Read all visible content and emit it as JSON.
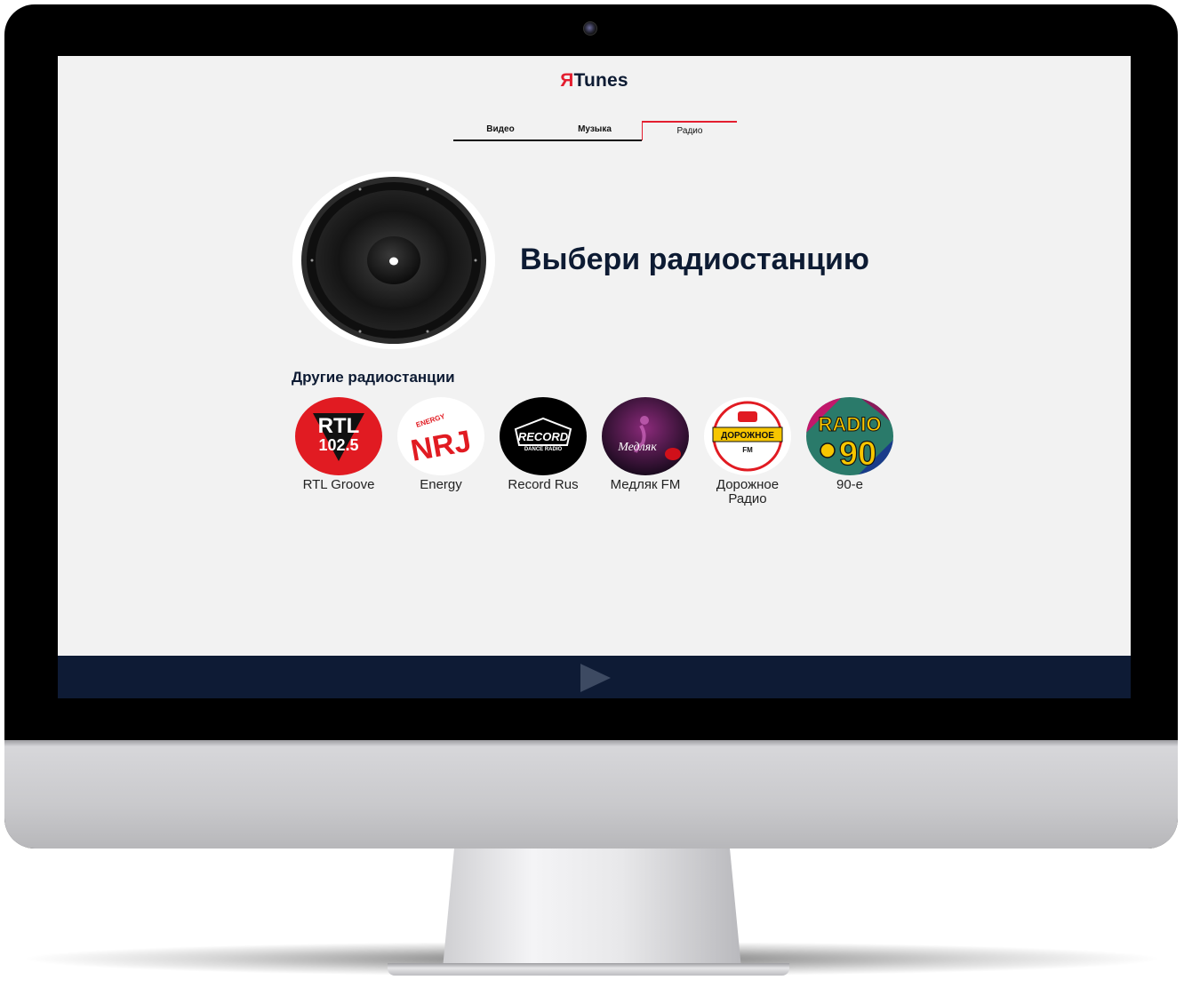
{
  "brand": {
    "mark": "Я",
    "name": "Tunes"
  },
  "tabs": [
    {
      "label": "Видео"
    },
    {
      "label": "Музыка"
    },
    {
      "label": "Радио",
      "active": true
    }
  ],
  "hero": {
    "title": "Выбери радиостанцию",
    "image": "speaker"
  },
  "other": {
    "title": "Другие радиостанции",
    "stations": [
      {
        "name": "RTL Groove",
        "logo_text": "RTL",
        "logo_sub": "102.5"
      },
      {
        "name": "Energy",
        "logo_text": "NRJ",
        "logo_sub": "ENERGY"
      },
      {
        "name": "Record Rus",
        "logo_text": "RECORD",
        "logo_sub": "DANCE RADIO"
      },
      {
        "name": "Медляк FM",
        "logo_text": "Медляк"
      },
      {
        "name": "Дорожное Радио",
        "logo_text": "ДОРОЖНОЕ",
        "logo_sub": "FM"
      },
      {
        "name": "90-е",
        "logo_text": "RADIO",
        "logo_sub": "90"
      }
    ]
  },
  "player": {
    "icon": "play-icon"
  },
  "colors": {
    "accent": "#e31e2f",
    "navy": "#0e1b35",
    "background": "#f2f2f2"
  }
}
